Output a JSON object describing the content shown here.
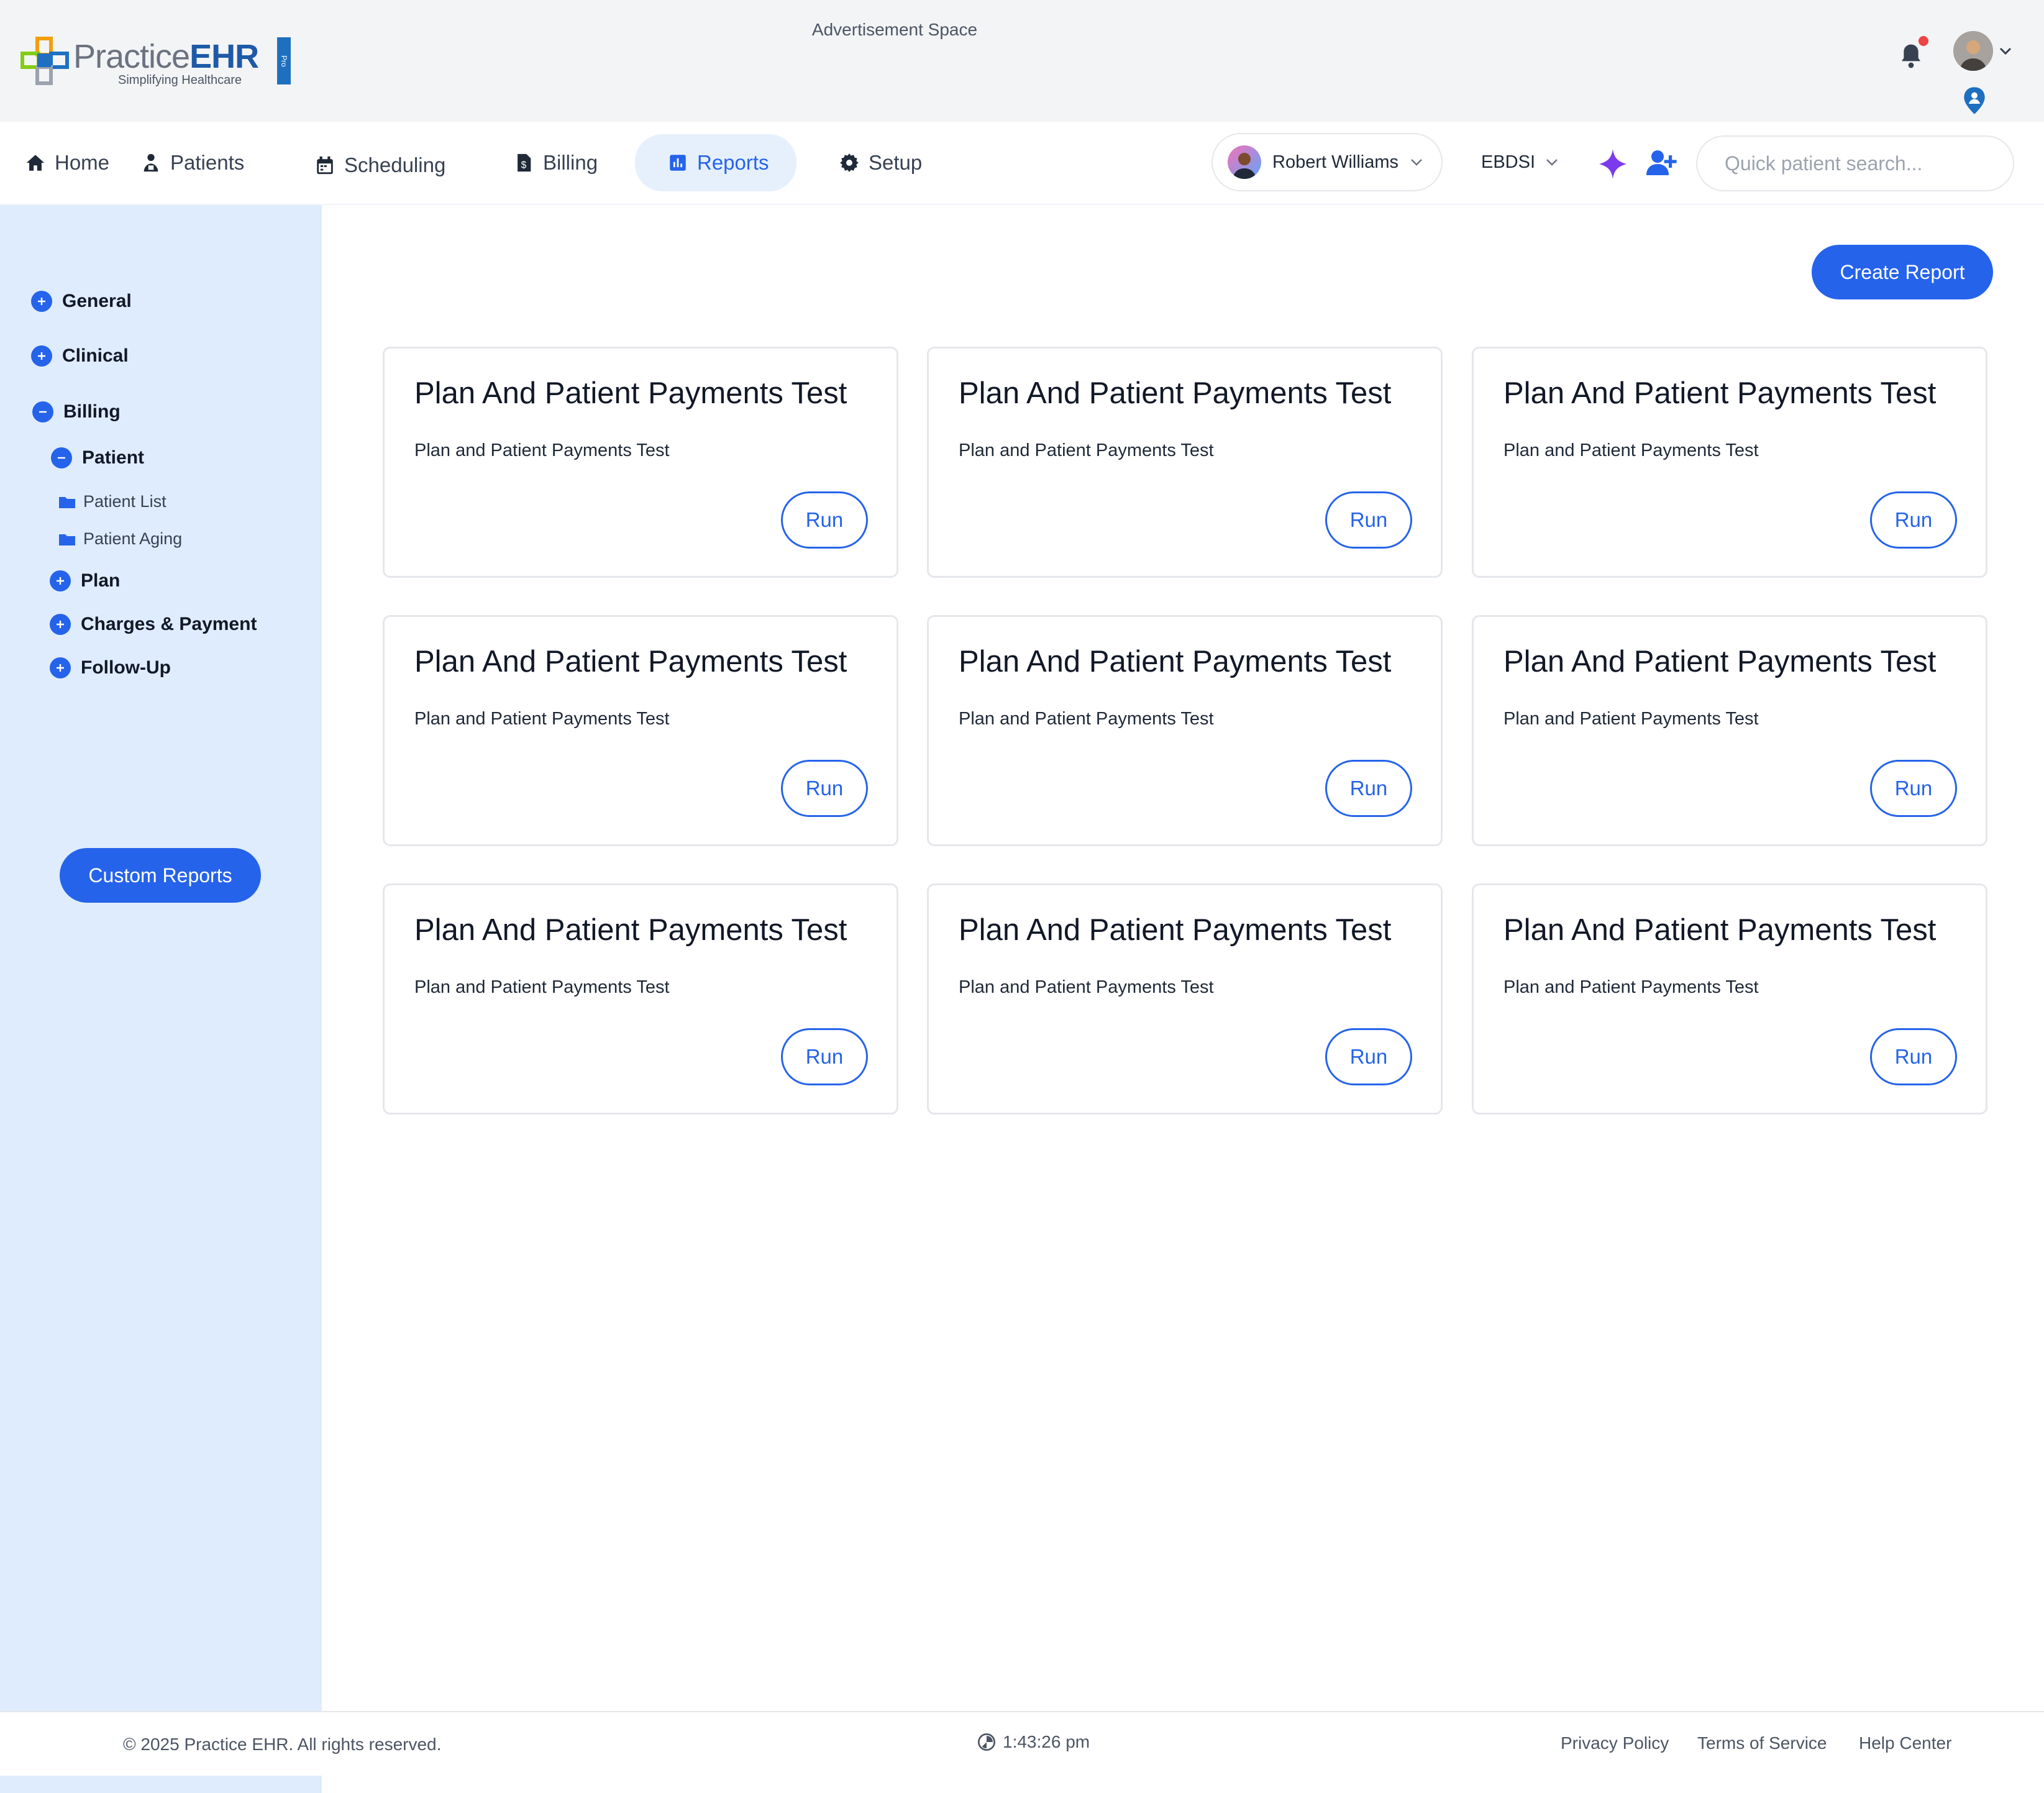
{
  "brand": {
    "name_practice": "Practice",
    "name_ehr": "EHR",
    "tagline": "Simplifying Healthcare",
    "badge": "Pro"
  },
  "header": {
    "advertisement": "Advertisement Space"
  },
  "nav": {
    "home": "Home",
    "patients": "Patients",
    "scheduling": "Scheduling",
    "billing": "Billing",
    "reports": "Reports",
    "setup": "Setup",
    "active": "Reports"
  },
  "provider": {
    "name": "Robert Williams"
  },
  "facility": {
    "code": "EBDSI"
  },
  "search": {
    "placeholder": "Quick patient search..."
  },
  "sidebar": {
    "general": "General",
    "clinical": "Clinical",
    "billing": "Billing",
    "patient": "Patient",
    "patient_list": "Patient List",
    "patient_aging": "Patient Aging",
    "plan": "Plan",
    "charges_payment": "Charges & Payment",
    "follow_up": "Follow-Up",
    "custom_reports": "Custom Reports"
  },
  "main": {
    "create_report": "Create Report",
    "run_label": "Run",
    "cards": [
      {
        "title": "Plan And Patient Payments Test",
        "subtitle": "Plan and Patient Payments Test"
      },
      {
        "title": "Plan And Patient Payments Test",
        "subtitle": "Plan and Patient Payments Test"
      },
      {
        "title": "Plan And Patient Payments Test",
        "subtitle": "Plan and Patient Payments Test"
      },
      {
        "title": "Plan And Patient Payments Test",
        "subtitle": "Plan and Patient Payments Test"
      },
      {
        "title": "Plan And Patient Payments Test",
        "subtitle": "Plan and Patient Payments Test"
      },
      {
        "title": "Plan And Patient Payments Test",
        "subtitle": "Plan and Patient Payments Test"
      },
      {
        "title": "Plan And Patient Payments Test",
        "subtitle": "Plan and Patient Payments Test"
      },
      {
        "title": "Plan And Patient Payments Test",
        "subtitle": "Plan and Patient Payments Test"
      },
      {
        "title": "Plan And Patient Payments Test",
        "subtitle": "Plan and Patient Payments Test"
      }
    ]
  },
  "footer": {
    "copyright": "© 2025 Practice EHR. All rights reserved.",
    "time": "1:43:26 pm",
    "privacy": "Privacy Policy",
    "terms": "Terms of Service",
    "help": "Help Center"
  },
  "colors": {
    "accent": "#2563eb",
    "sidebar_bg": "#dfecfd",
    "active_tab_bg": "#e6f0fd",
    "notification_dot": "#ef4444"
  }
}
